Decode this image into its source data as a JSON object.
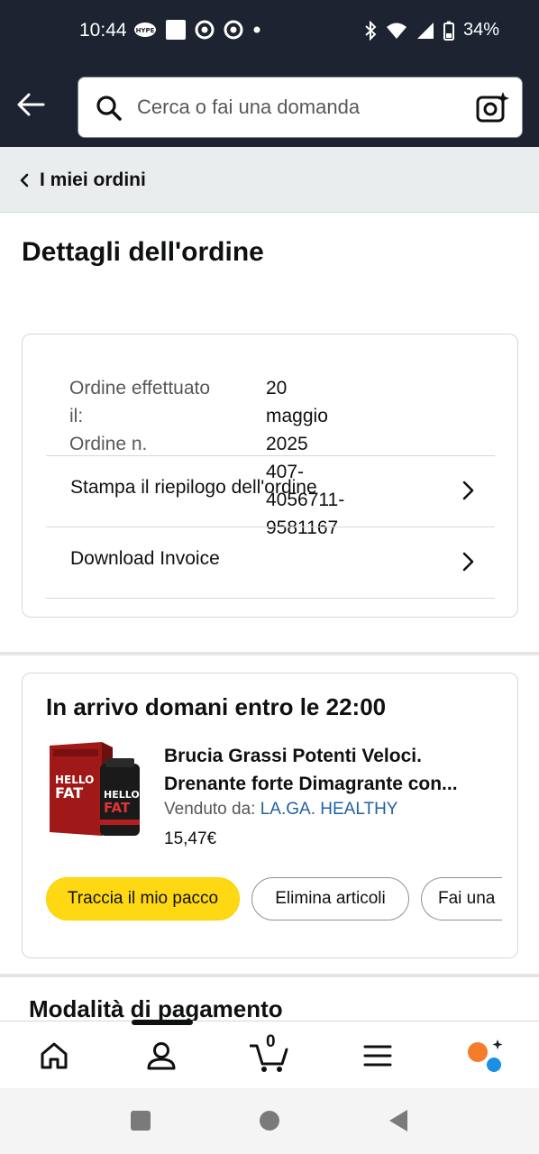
{
  "status_bar": {
    "time": "10:44",
    "battery": "34%",
    "icons": [
      "hype-icon",
      "square-icon",
      "chrome-icon",
      "chrome-icon",
      "dot-icon",
      "bluetooth-icon",
      "wifi-icon",
      "signal-icon",
      "battery-icon"
    ]
  },
  "header": {
    "search_placeholder": "Cerca o fai una domanda"
  },
  "breadcrumb": {
    "label": "I miei ordini"
  },
  "page": {
    "title": "Dettagli dell'ordine"
  },
  "order": {
    "placed_label_line1": "Ordine effettuato",
    "placed_label_line2": "il:",
    "number_label": "Ordine n.",
    "placed_date": "20 maggio 2025",
    "number": "407-4056711-9581167",
    "links": [
      {
        "label": "Stampa il riepilogo dell'ordine"
      },
      {
        "label": "Download Invoice"
      }
    ]
  },
  "delivery": {
    "title": "In arrivo domani entro le 22:00",
    "product_title_line1": "Brucia Grassi Potenti Veloci.",
    "product_title_line2": "Drenante forte Dimagrante con...",
    "sold_by_label": "Venduto da:",
    "seller": "LA.GA. HEALTHY",
    "price": "15,47€",
    "image_text_top": "HELLO",
    "image_text_bottom": "FAT",
    "buttons": {
      "track": "Traccia il mio pacco",
      "delete": "Elimina articoli",
      "ask": "Fai una"
    }
  },
  "payment": {
    "title": "Modalità di pagamento"
  },
  "bottom_nav": {
    "cart_count": "0",
    "items": [
      "home-icon",
      "account-icon",
      "cart-icon",
      "menu-icon",
      "rufus-icon"
    ]
  },
  "colors": {
    "header_bg": "#1d2330",
    "accent_yellow": "#ffd814",
    "link_blue": "#2162a1",
    "rufus_orange": "#f57c2a",
    "rufus_blue": "#1a8fe3"
  }
}
